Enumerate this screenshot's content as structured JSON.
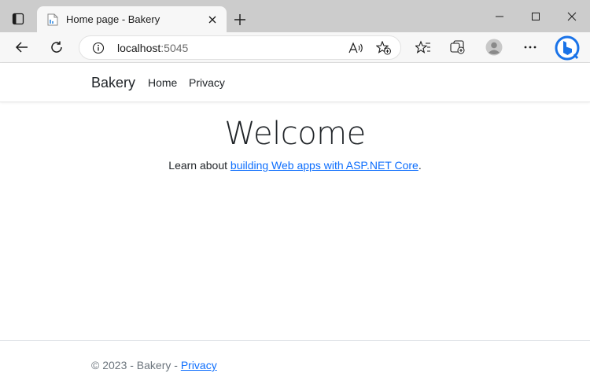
{
  "browser": {
    "tab_title": "Home page - Bakery",
    "url_host": "localhost",
    "url_port": ":5045"
  },
  "site": {
    "brand": "Bakery",
    "nav": {
      "home": "Home",
      "privacy": "Privacy"
    }
  },
  "main": {
    "heading": "Welcome",
    "lead_prefix": "Learn about ",
    "lead_link": "building Web apps with ASP.NET Core",
    "lead_suffix": "."
  },
  "footer": {
    "text": "© 2023 - Bakery - ",
    "privacy_link": "Privacy"
  },
  "colors": {
    "link": "#0d6efd",
    "tabstrip": "#cccccc",
    "toolbar": "#f7f7f7",
    "bing_accent": "#1a73e8"
  }
}
